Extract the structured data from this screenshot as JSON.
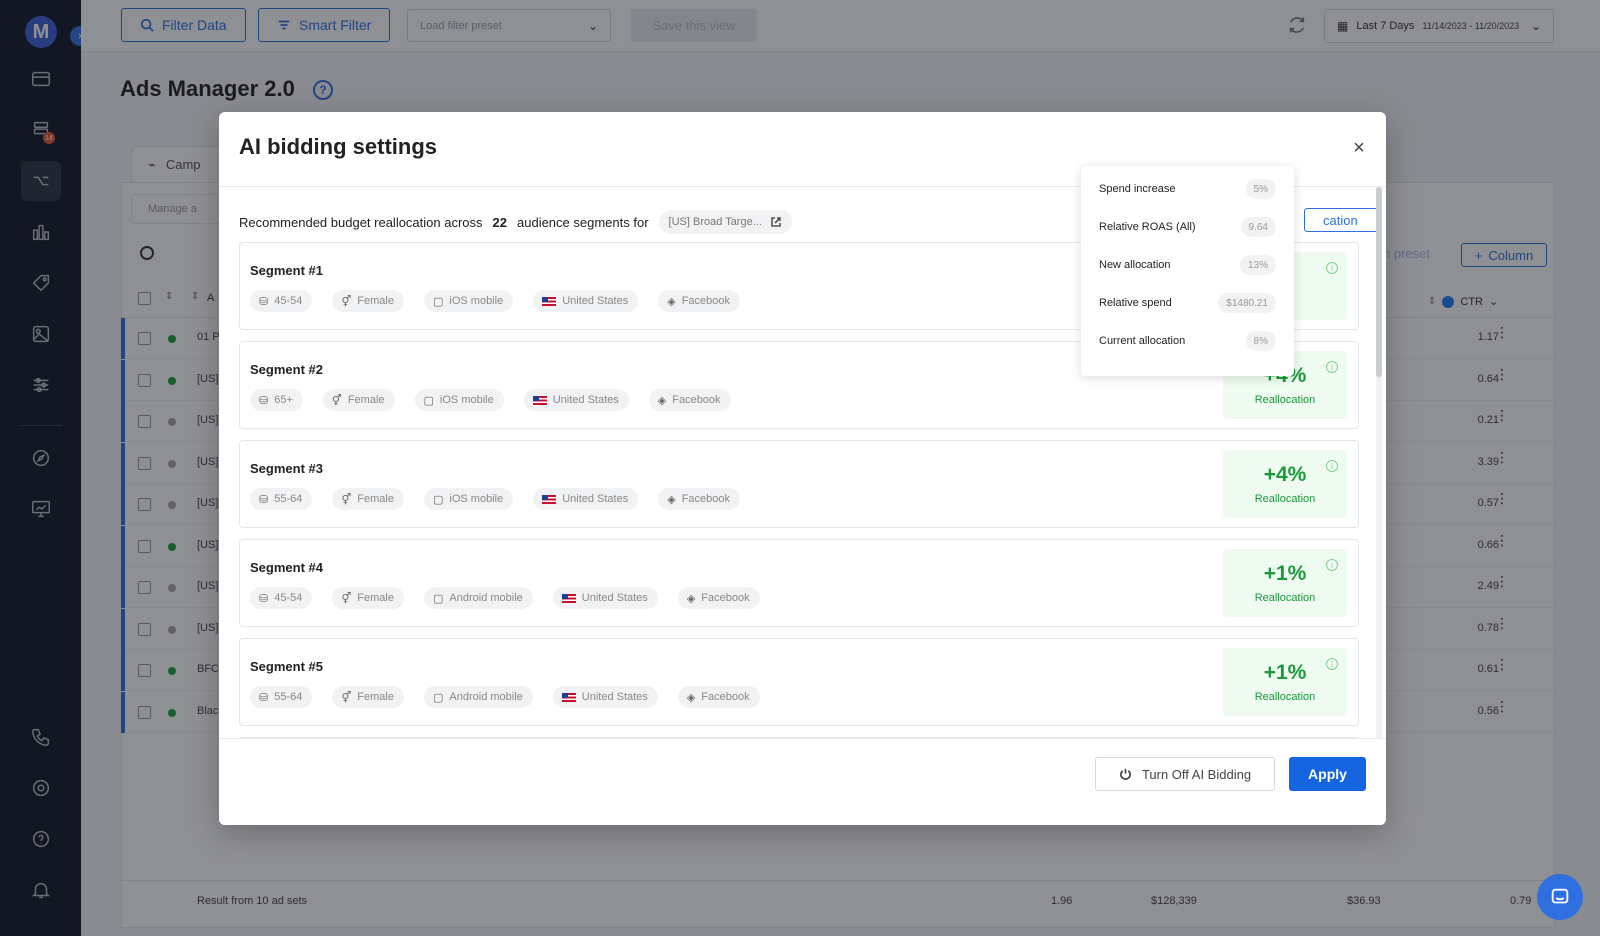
{
  "toolbar": {
    "filter_data": "Filter Data",
    "smart_filter": "Smart Filter",
    "preset_placeholder": "Load filter preset",
    "save_view": "Save this view",
    "date_label": "Last 7 Days",
    "date_range": "11/14/2023 - 11/20/2023"
  },
  "page": {
    "title": "Ads Manager 2.0",
    "help": "?"
  },
  "background": {
    "tab_label": "Camp",
    "manage_label": "Manage a",
    "column_button": "Column",
    "preset_label": "n preset",
    "ctr_label": "CTR",
    "col_a": "A",
    "rows": [
      {
        "name": "01 P",
        "active": true,
        "value": "1.17"
      },
      {
        "name": "[US]",
        "active": true,
        "value": "0.64"
      },
      {
        "name": "[US]",
        "active": false,
        "value": "0.21"
      },
      {
        "name": "[US]",
        "active": false,
        "value": "3.39"
      },
      {
        "name": "[US]",
        "active": false,
        "value": "0.57"
      },
      {
        "name": "[US]",
        "active": true,
        "value": "0.66"
      },
      {
        "name": "[US]",
        "active": false,
        "value": "2.49"
      },
      {
        "name": "[US]",
        "active": false,
        "value": "0.78"
      },
      {
        "name": "BFC",
        "active": true,
        "value": "0.61"
      },
      {
        "name": "Blac",
        "active": true,
        "value": "0.56"
      }
    ],
    "footer": {
      "result": "Result from 10 ad sets",
      "v1": "1.96",
      "v2": "$128,339",
      "v3": "$36.93",
      "v4": "0.79"
    }
  },
  "modal": {
    "title": "AI bidding settings",
    "close": "×",
    "intro_before": "Recommended budget reallocation across",
    "segment_count": "22",
    "intro_after": "audience segments for",
    "campaign": "[US] Broad Targe...",
    "apply_all": "cation",
    "segments": [
      {
        "name": "Segment #1",
        "age": "45-54",
        "gender": "Female",
        "device": "iOS mobile",
        "country": "United States",
        "platform": "Facebook",
        "pct": "",
        "label": "n"
      },
      {
        "name": "Segment #2",
        "age": "65+",
        "gender": "Female",
        "device": "iOS mobile",
        "country": "United States",
        "platform": "Facebook",
        "pct": "+4%",
        "label": "Reallocation"
      },
      {
        "name": "Segment #3",
        "age": "55-64",
        "gender": "Female",
        "device": "iOS mobile",
        "country": "United States",
        "platform": "Facebook",
        "pct": "+4%",
        "label": "Reallocation"
      },
      {
        "name": "Segment #4",
        "age": "45-54",
        "gender": "Female",
        "device": "Android mobile",
        "country": "United States",
        "platform": "Facebook",
        "pct": "+1%",
        "label": "Reallocation"
      },
      {
        "name": "Segment #5",
        "age": "55-64",
        "gender": "Female",
        "device": "Android mobile",
        "country": "United States",
        "platform": "Facebook",
        "pct": "+1%",
        "label": "Reallocation"
      }
    ],
    "turn_off": "Turn Off AI Bidding",
    "apply": "Apply"
  },
  "tooltip": {
    "rows": [
      {
        "key": "Spend increase",
        "value": "5%"
      },
      {
        "key": "Relative ROAS (All)",
        "value": "9.64"
      },
      {
        "key": "New allocation",
        "value": "13%"
      },
      {
        "key": "Relative spend",
        "value": "$1480.21"
      },
      {
        "key": "Current allocation",
        "value": "8%"
      }
    ]
  }
}
